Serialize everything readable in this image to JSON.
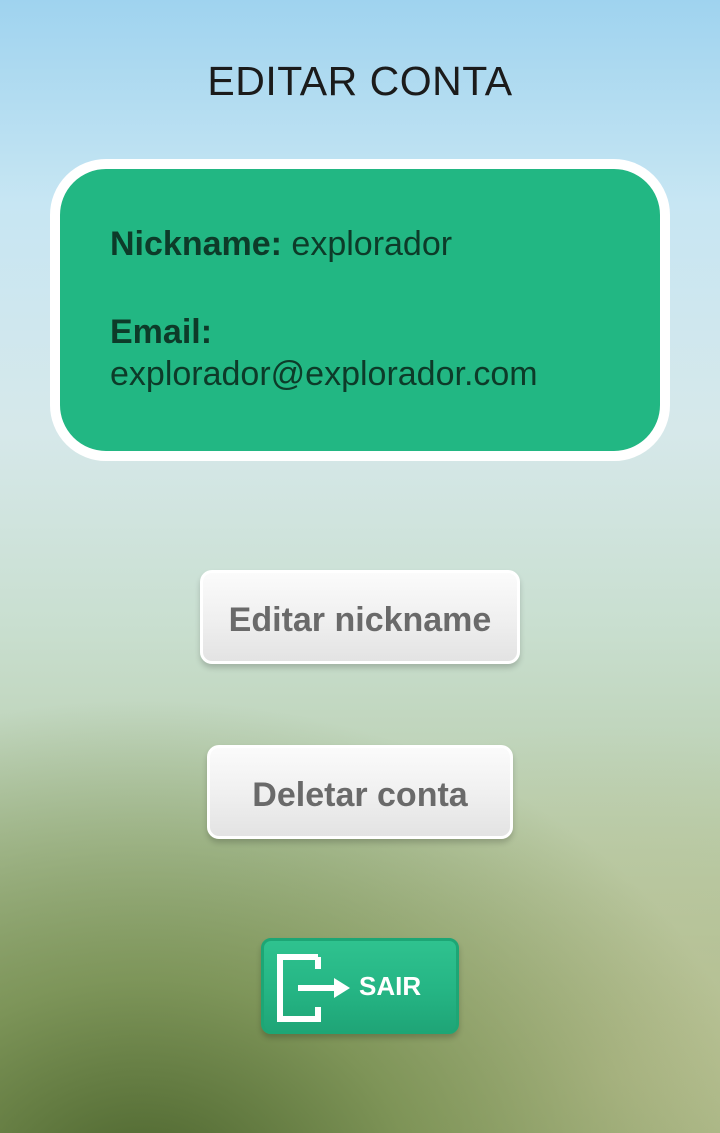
{
  "header": {
    "title": "EDITAR CONTA"
  },
  "account": {
    "nickname_label": "Nickname:",
    "nickname_value": "explorador",
    "email_label": "Email:",
    "email_value": "explorador@explorador.com"
  },
  "actions": {
    "edit_nickname_label": "Editar nickname",
    "delete_account_label": "Deletar conta",
    "exit_label": "SAIR",
    "exit_icon": "exit-icon"
  },
  "colors": {
    "card_green": "#22b783",
    "card_text": "#0d3b29",
    "button_text": "#6a6a6a",
    "exit_green": "#25b584"
  }
}
